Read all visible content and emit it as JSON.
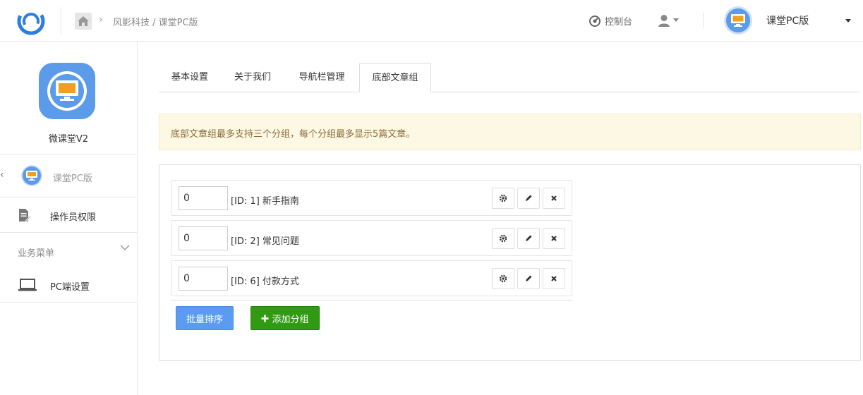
{
  "header": {
    "breadcrumb": "风影科技 / 课堂PC版",
    "console_label": "控制台",
    "app_switch_name": "课堂PC版"
  },
  "sidebar": {
    "app_name": "微课堂V2",
    "current_app": "课堂PC版",
    "items": [
      {
        "label": "操作员权限",
        "icon": "document-edit-icon"
      },
      {
        "label": "PC端设置",
        "icon": "laptop-icon"
      }
    ],
    "group_label": "业务菜单"
  },
  "tabs": [
    {
      "label": "基本设置",
      "active": false
    },
    {
      "label": "关于我们",
      "active": false
    },
    {
      "label": "导航栏管理",
      "active": false
    },
    {
      "label": "底部文章组",
      "active": true
    }
  ],
  "alert_text": "底部文章组最多支持三个分组，每个分组最多显示5篇文章。",
  "groups": [
    {
      "order": "0",
      "label": "[ID: 1] 新手指南"
    },
    {
      "order": "0",
      "label": "[ID: 2] 常见问题"
    },
    {
      "order": "0",
      "label": "[ID: 6] 付款方式"
    }
  ],
  "buttons": {
    "batch_sort": "批量排序",
    "add_group": "添加分组"
  },
  "colors": {
    "primary": "#5b9bf2",
    "success": "#2f9a12",
    "app_blue": "#5b9bea",
    "alert_bg": "#fcf8e3"
  }
}
